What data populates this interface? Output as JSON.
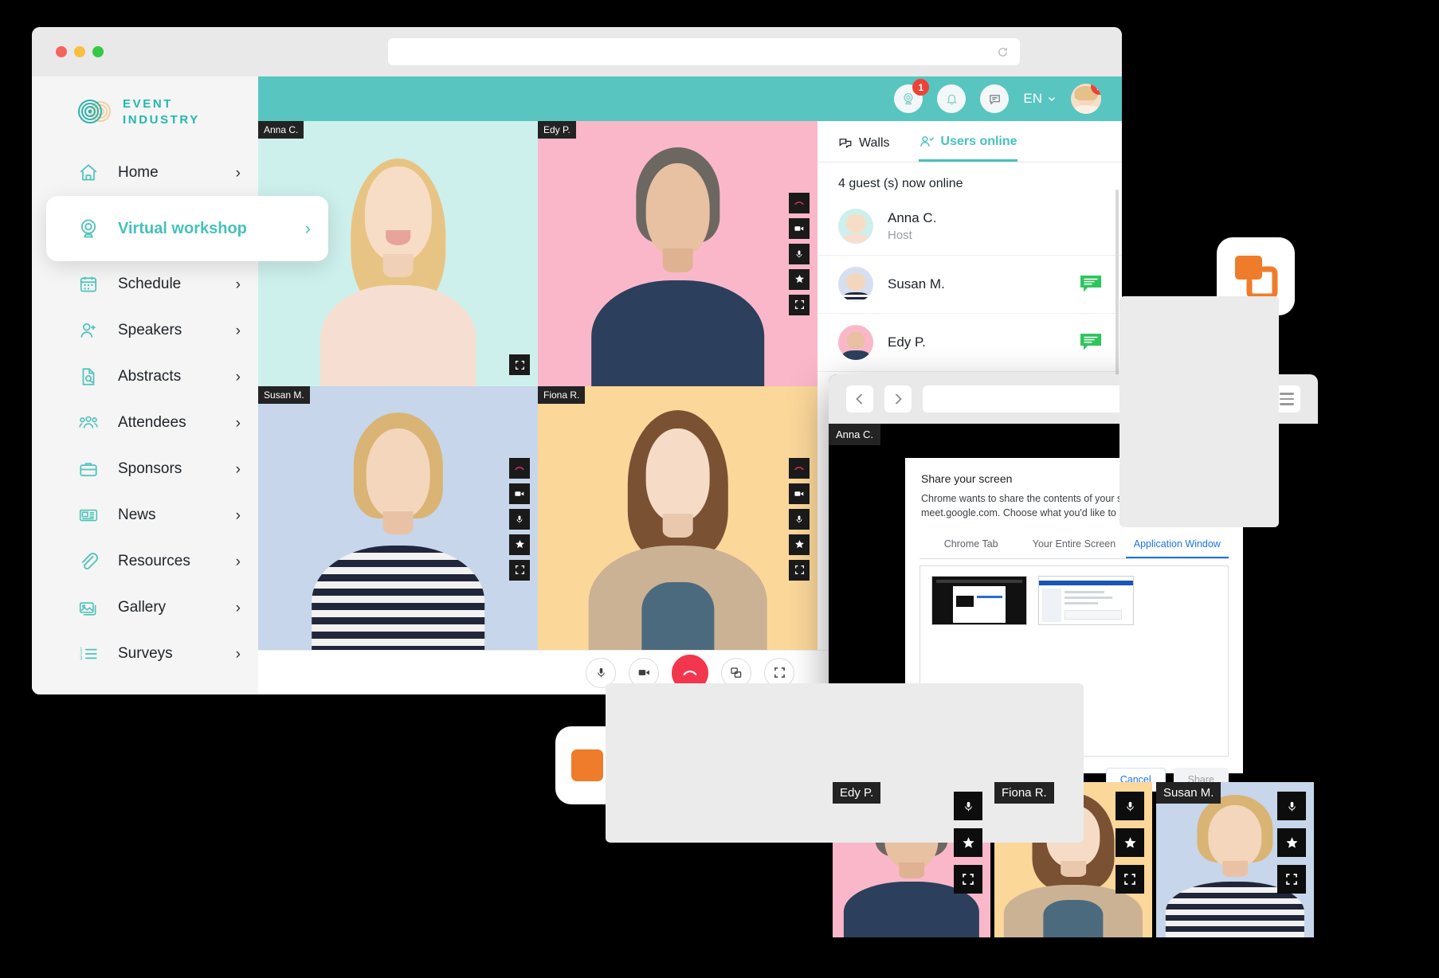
{
  "main_window": {
    "titlebar": {
      "traffic_lights": [
        "close",
        "minimize",
        "maximize"
      ],
      "url_value": "",
      "url_placeholder": "",
      "reload_icon": "reload-icon"
    },
    "brand": {
      "line1": "EVENT",
      "line2": "INDUSTRY",
      "logo_icon": "event-industry-logo"
    },
    "sidebar": {
      "items": [
        {
          "label": "Home",
          "icon": "home-icon",
          "chevron": "›",
          "active": false
        },
        {
          "label": "Virtual workshop",
          "icon": "webcam-icon",
          "chevron": "›",
          "active": true
        },
        {
          "label": "Schedule",
          "icon": "calendar-icon",
          "chevron": "›",
          "active": false
        },
        {
          "label": "Speakers",
          "icon": "user-plus-icon",
          "chevron": "›",
          "active": false
        },
        {
          "label": "Abstracts",
          "icon": "document-search-icon",
          "chevron": "›",
          "active": false
        },
        {
          "label": "Attendees",
          "icon": "people-group-icon",
          "chevron": "›",
          "active": false
        },
        {
          "label": "Sponsors",
          "icon": "briefcase-icon",
          "chevron": "›",
          "active": false
        },
        {
          "label": "News",
          "icon": "newspaper-icon",
          "chevron": "›",
          "active": false
        },
        {
          "label": "Resources",
          "icon": "paperclip-icon",
          "chevron": "›",
          "active": false
        },
        {
          "label": "Gallery",
          "icon": "gallery-icon",
          "chevron": "›",
          "active": false
        },
        {
          "label": "Surveys",
          "icon": "numbered-list-icon",
          "chevron": "›",
          "active": false
        }
      ]
    },
    "app_header": {
      "background_color": "#58c5c0",
      "buttons": [
        {
          "icon": "webcam-icon",
          "badge": "1"
        },
        {
          "icon": "bell-icon",
          "badge": ""
        },
        {
          "icon": "chat-bubble-icon",
          "badge": ""
        }
      ],
      "language": {
        "label": "EN",
        "chevron": "⌄"
      },
      "avatar": {
        "icon": "avatar",
        "badge": "1"
      }
    },
    "video_grid": {
      "tiles": [
        {
          "name": "Anna C.",
          "bg": "#cdf0ec",
          "controls": [
            "fullscreen-icon"
          ]
        },
        {
          "name": "Edy P.",
          "bg": "#fbb7ca",
          "controls": [
            "hangup-icon",
            "camera-icon",
            "mic-icon",
            "star-icon",
            "fullscreen-icon"
          ]
        },
        {
          "name": "Susan M.",
          "bg": "#c7d6ea",
          "controls": [
            "hangup-icon",
            "camera-icon",
            "mic-icon",
            "star-icon",
            "fullscreen-icon"
          ]
        },
        {
          "name": "Fiona R.",
          "bg": "#fbd79a",
          "controls": [
            "hangup-icon",
            "camera-icon",
            "mic-icon",
            "star-icon",
            "fullscreen-icon"
          ]
        }
      ]
    },
    "right_panel": {
      "tabs": [
        {
          "label": "Walls",
          "icon": "chat-bubbles-icon",
          "active": false
        },
        {
          "label": "Users online",
          "icon": "user-check-icon",
          "active": true
        }
      ],
      "count_text": "4 guest (s) now online",
      "users": [
        {
          "name": "Anna C.",
          "role": "Host",
          "avatar_bg": "#cdf0ec",
          "has_chat": false
        },
        {
          "name": "Susan M.",
          "role": "",
          "avatar_bg": "#d5dff0",
          "has_chat": true
        },
        {
          "name": "Edy P.",
          "role": "",
          "avatar_bg": "#fbb7ca",
          "has_chat": true
        }
      ]
    },
    "call_bar": {
      "buttons": [
        {
          "icon": "mic-icon",
          "variant": "normal"
        },
        {
          "icon": "camera-icon",
          "variant": "normal"
        },
        {
          "icon": "hangup-icon",
          "variant": "hangup"
        },
        {
          "icon": "screen-share-icon",
          "variant": "normal"
        },
        {
          "icon": "fullscreen-icon",
          "variant": "normal"
        }
      ],
      "right_button": {
        "icon": "collapse-panel-icon"
      },
      "hangup_color": "#f2364d"
    }
  },
  "front_window": {
    "titlebar": {
      "back_icon": "chevron-left-icon",
      "forward_icon": "chevron-right-icon",
      "url_value": "",
      "reload_icon": "reload-icon",
      "menu_icon": "hamburger-menu-icon"
    },
    "stage_label": "Anna C.",
    "share_dialog": {
      "title": "Share your screen",
      "description": "Chrome wants to share the contents of your screen with meet.google.com. Choose what you'd like to share.",
      "tabs": [
        {
          "label": "Chrome Tab",
          "active": false
        },
        {
          "label": "Your Entire Screen",
          "active": false
        },
        {
          "label": "Application Window",
          "active": true
        }
      ],
      "thumbnails": [
        "window-preview-dark",
        "window-preview-light"
      ],
      "buttons": [
        {
          "label": "Cancel",
          "variant": "cancel"
        },
        {
          "label": "Share",
          "variant": "share-disabled"
        }
      ],
      "accent_color": "#1a73e8"
    },
    "filmstrip": [
      {
        "name": "Edy P.",
        "bg": "#fbb7ca",
        "controls": [
          "mic-icon",
          "star-icon",
          "fullscreen-icon"
        ]
      },
      {
        "name": "Fiona R.",
        "bg": "#fbd79a",
        "controls": [
          "mic-icon",
          "star-icon",
          "fullscreen-icon"
        ]
      },
      {
        "name": "Susan M.",
        "bg": "#c7d6ea",
        "controls": [
          "mic-icon",
          "star-icon",
          "fullscreen-icon"
        ]
      }
    ]
  },
  "floating_icons": [
    {
      "name": "screen-share-app-icon",
      "color": "#ef7c2a"
    },
    {
      "name": "video-camera-app-icon",
      "color": "#ef7c2a"
    }
  ],
  "colors": {
    "brand_teal": "#46c1bb",
    "header_teal": "#58c5c0",
    "badge_red": "#ef4136",
    "hangup_red": "#f2364d",
    "chat_green": "#2fc45c",
    "orange": "#ef7c2a",
    "chrome_blue": "#1a73e8"
  }
}
